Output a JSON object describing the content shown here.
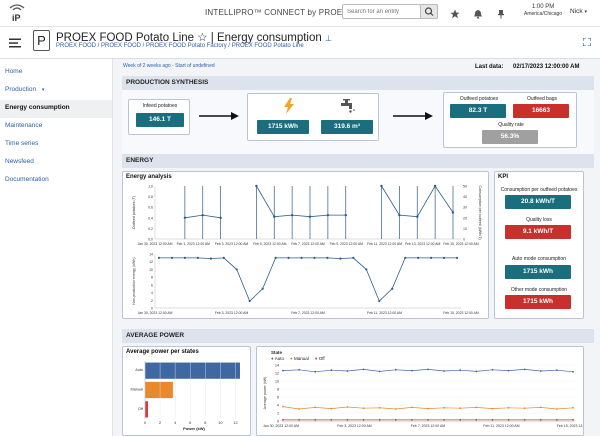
{
  "app": {
    "title": "INTELLIPRO™ CONNECT by PROEX FOOD",
    "logo_text": "iP"
  },
  "search": {
    "placeholder": "Search for an entity"
  },
  "clock": {
    "time": "1:00 PM",
    "zone": "America/Chicago"
  },
  "user": {
    "name": "Nick"
  },
  "page": {
    "title": "PROEX FOOD Potato Line ☆ | Energy consumption",
    "breadcrumb": "PROEX FOOD / PROEX FOOD / PROEX FOOD Potato Factory / PROEX FOOD Potato Line"
  },
  "sidebar": {
    "items": [
      {
        "label": "Home"
      },
      {
        "label": "Production"
      },
      {
        "label": "Energy consumption"
      },
      {
        "label": "Maintenance"
      },
      {
        "label": "Time series"
      },
      {
        "label": "Newsfeed"
      },
      {
        "label": "Documentation"
      }
    ]
  },
  "main": {
    "week_note": "Week of 2 weeks ago - Start of undefined",
    "last_data_label": "Last data:",
    "last_data_value": "02/17/2023 12:00:00 AM",
    "production_synthesis": {
      "title": "PRODUCTION SYNTHESIS",
      "infeed_label": "Infeed potatoes",
      "infeed_value": "146.1 T",
      "energy_value": "1715 kWh",
      "water_value": "319.6 m³",
      "outfeed_label": "Outfeed potatoes",
      "outfeed_value": "82.3 T",
      "bags_label": "Outfeed bags",
      "bags_value": "16663",
      "quality_label": "Quality rate",
      "quality_value": "56.3%"
    },
    "energy": {
      "title": "ENERGY",
      "analysis_title": "Energy analysis",
      "kpi_title": "KPI",
      "kpis": [
        {
          "label": "Consumption per outfeed potatoes",
          "value": "20.8 kWh/T",
          "color": "#1b6e7e"
        },
        {
          "label": "Quality loss",
          "value": "9.1 kWh/T",
          "color": "#c9302c"
        },
        {
          "label": "Auto mode consumption",
          "value": "1715 kWh",
          "color": "#1b6e7e"
        },
        {
          "label": "Other mode consumption",
          "value": "1715 kWh",
          "color": "#c9302c"
        }
      ]
    },
    "average_power": {
      "title": "AVERAGE POWER",
      "per_state_title": "Average power per states",
      "legend_title": "State",
      "states": [
        "Auto",
        "Manual",
        "Off"
      ]
    }
  },
  "chart_data": [
    {
      "type": "line",
      "title": "Energy analysis",
      "ylabel": "Outfeed potatoes (T)",
      "y2label": "Consumption per outfeed (kWh/T)",
      "x": [
        "Jan 30, 2023 12:00 AM",
        "Feb 1, 2023 12:00 AM",
        "Feb 3, 2023 12:00 AM",
        "Feb 5, 2023 12:00 AM",
        "Feb 7, 2023 12:00 AM",
        "Feb 9, 2023 12:00 AM",
        "Feb 11, 2023 12:00 AM",
        "Feb 13, 2023 12:00 AM",
        "Feb 15, 2023 12:00 AM"
      ],
      "yticks": [
        "0.0",
        "0.2",
        "0.4",
        "0.6",
        "0.8",
        "1.0"
      ],
      "y2ticks": [
        "0",
        "10",
        "20",
        "30",
        "40",
        "50"
      ],
      "series": [
        {
          "values": [
            null,
            0.4,
            0.45,
            0.4,
            null,
            1.0,
            0.42,
            0.45,
            0.42,
            0.45,
            0.45,
            null,
            1.0,
            0.45,
            0.42,
            1.0,
            0.5
          ]
        }
      ]
    },
    {
      "type": "line",
      "ylabel": "Non-production energy (kWh)",
      "x": [
        "Jan 30, 2023 12:00 AM",
        "Feb 3, 2023 12:00 AM",
        "Feb 7, 2023 12:00 AM",
        "Feb 11, 2023 12:00 AM",
        "Feb 15, 2023 12:00 AM"
      ],
      "yticks": [
        "0",
        "2",
        "4",
        "6",
        "8",
        "10",
        "12",
        "14"
      ],
      "series": [
        {
          "values": [
            13,
            13,
            13,
            13,
            12.8,
            13,
            10,
            1.8,
            5,
            13,
            13,
            13,
            13,
            13,
            12.8,
            13,
            10,
            1.8,
            5,
            13,
            13,
            13,
            13,
            13
          ]
        }
      ]
    },
    {
      "type": "bar",
      "title": "Average power per states",
      "categories": [
        "Auto",
        "Manual",
        "Off"
      ],
      "values": [
        12.6,
        3.7,
        0.4
      ],
      "xlabel": "Power (kW)",
      "xticks": [
        "0",
        "2",
        "4",
        "6",
        "8",
        "10",
        "12"
      ],
      "colors": [
        "#3f68a3",
        "#e8892b",
        "#d93a3a"
      ]
    },
    {
      "type": "line",
      "ylabel": "Average power (kW)",
      "x": [
        "Jan 30, 2023 12:00 AM",
        "Feb 3, 2023 12:00 AM",
        "Feb 7, 2023 12:00 AM",
        "Feb 11, 2023 12:00 AM",
        "Feb 15, 2023 12:00 AM"
      ],
      "yticks": [
        "0",
        "2",
        "4",
        "6",
        "8",
        "10",
        "12",
        "14"
      ],
      "series": [
        {
          "name": "Auto",
          "values": [
            12.6,
            12.8,
            12.3,
            12.7,
            12.5,
            12.9,
            12.4,
            12.8,
            12.6,
            12.9,
            12.5,
            12.7,
            12.4,
            12.8,
            12.6,
            12.9,
            12.5,
            12.7,
            12.3
          ]
        },
        {
          "name": "Manual",
          "values": [
            3.6,
            3.0,
            3.4,
            3.1,
            3.5,
            3.2,
            3.3,
            3.0,
            3.4,
            3.1,
            3.3,
            3.2,
            3.4,
            3.1,
            3.3,
            3.2,
            3.4,
            3.0,
            3.3
          ]
        },
        {
          "name": "Off",
          "values": [
            0.3,
            0.3,
            0.3,
            0.3,
            0.3,
            0.3,
            0.3,
            0.3,
            0.3,
            0.3,
            0.3,
            0.3,
            0.3,
            0.3,
            0.3,
            0.3,
            0.3,
            0.3,
            0.3
          ]
        }
      ],
      "colors": [
        "#3f68a3",
        "#e8892b",
        "#d93a3a"
      ]
    }
  ]
}
